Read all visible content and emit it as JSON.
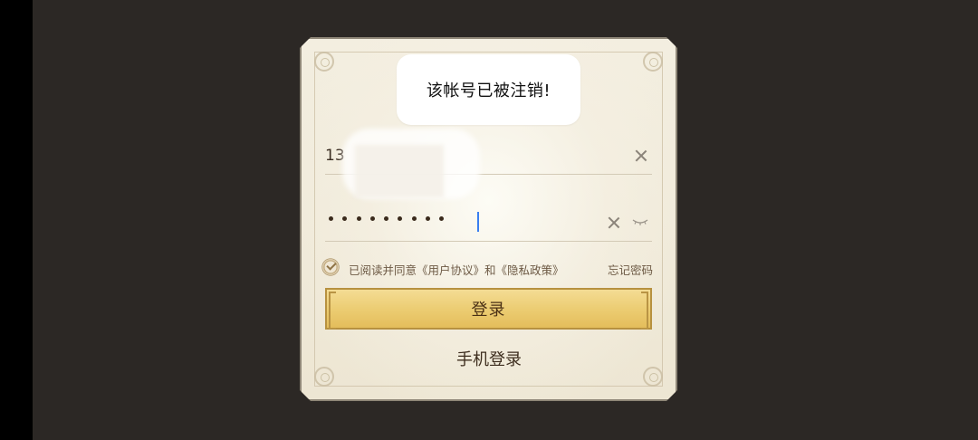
{
  "toast": {
    "message": "该帐号已被注销!"
  },
  "account": {
    "value_prefix": "13"
  },
  "password": {
    "masked_length": 9
  },
  "agreement": {
    "text": "已阅读并同意《用户协议》和《隐私政策》",
    "checked": true,
    "forgot_label": "忘记密码"
  },
  "buttons": {
    "login_label": "登录",
    "phone_login_label": "手机登录"
  },
  "colors": {
    "background": "#2c2825",
    "panel": "#f3eee0",
    "button_gold": "#eccd73",
    "caret": "#3a7ef0"
  }
}
